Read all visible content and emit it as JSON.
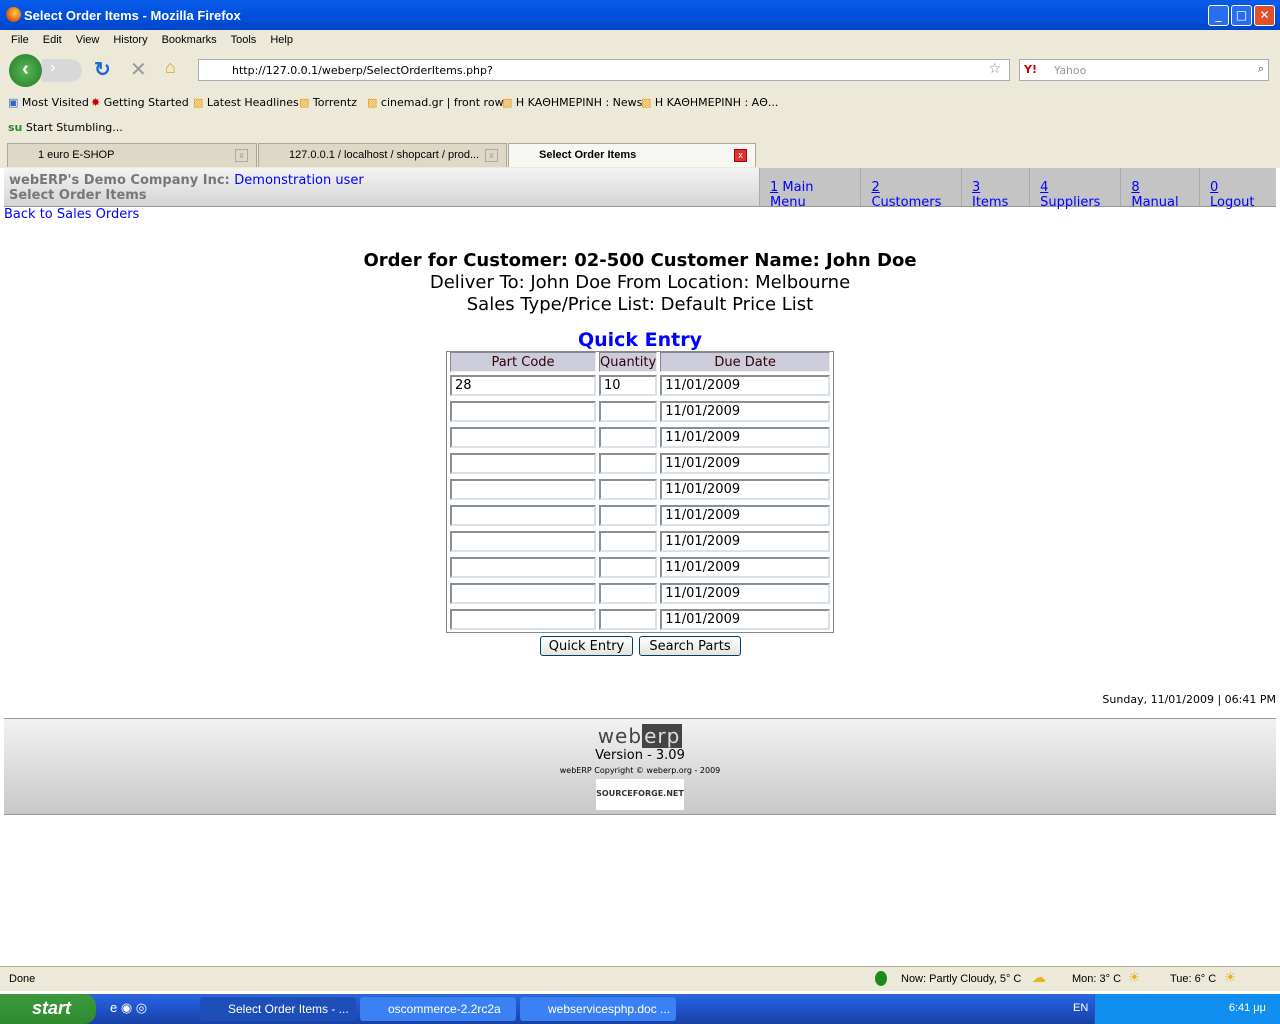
{
  "window": {
    "title": "Select Order Items - Mozilla Firefox"
  },
  "menubar": [
    "File",
    "Edit",
    "View",
    "History",
    "Bookmarks",
    "Tools",
    "Help"
  ],
  "url": "http://127.0.0.1/weberp/SelectOrderItems.php?",
  "search_placeholder": "Yahoo",
  "bookmarks": [
    "Most Visited",
    "Getting Started",
    "Latest Headlines",
    "Torrentz",
    "cinemad.gr | front row",
    "H KAΘHMEPINH : News",
    "H KAΘHMEPINH : AΘ..."
  ],
  "stumble": "Start Stumbling...",
  "tabs": [
    "1 euro E-SHOP",
    "127.0.0.1 / localhost / shopcart / prod...",
    "Select Order Items"
  ],
  "header": {
    "company": "webERP's Demo Company Inc:",
    "user": "Demonstration user",
    "page": "Select Order Items"
  },
  "nav": [
    {
      "key": "1",
      "label": " Main Menu"
    },
    {
      "key": "2",
      "label": " Customers"
    },
    {
      "key": "3",
      "label": " Items"
    },
    {
      "key": "4",
      "label": " Suppliers"
    },
    {
      "key": "8",
      "label": " Manual"
    },
    {
      "key": "0",
      "label": " Logout"
    }
  ],
  "back_link": "Back to Sales Orders",
  "order": {
    "line1": "Order for Customer: 02-500  Customer Name: John Doe",
    "line2": "Deliver To: John Doe  From Location: Melbourne",
    "line3": "Sales Type/Price List: Default Price List"
  },
  "quick_entry": {
    "title": "Quick Entry",
    "columns": [
      "Part Code",
      "Quantity",
      "Due Date"
    ],
    "rows": [
      [
        "28",
        "10",
        "11/01/2009"
      ],
      [
        "",
        "",
        "11/01/2009"
      ],
      [
        "",
        "",
        "11/01/2009"
      ],
      [
        "",
        "",
        "11/01/2009"
      ],
      [
        "",
        "",
        "11/01/2009"
      ],
      [
        "",
        "",
        "11/01/2009"
      ],
      [
        "",
        "",
        "11/01/2009"
      ],
      [
        "",
        "",
        "11/01/2009"
      ],
      [
        "",
        "",
        "11/01/2009"
      ],
      [
        "",
        "",
        "11/01/2009"
      ]
    ],
    "buttons": [
      "Quick Entry",
      "Search Parts"
    ]
  },
  "datetime": "Sunday, 11/01/2009 | 06:41 PM",
  "footer": {
    "logo": "webERP",
    "version": "Version - 3.09",
    "copyright": "webERP Copyright © weberp.org - 2009",
    "badge": "SOURCEFORGE.NET"
  },
  "statusbar": {
    "text": "Done",
    "weather_now": "Now: Partly Cloudy, 5° C",
    "mon": "Mon: 3° C",
    "tue": "Tue: 6° C"
  },
  "taskbar": {
    "start": "start",
    "items": [
      "Select Order Items - ...",
      "oscommerce-2.2rc2a",
      "webservicesphp.doc ..."
    ],
    "lang": "EN",
    "clock": "6:41 μμ"
  }
}
